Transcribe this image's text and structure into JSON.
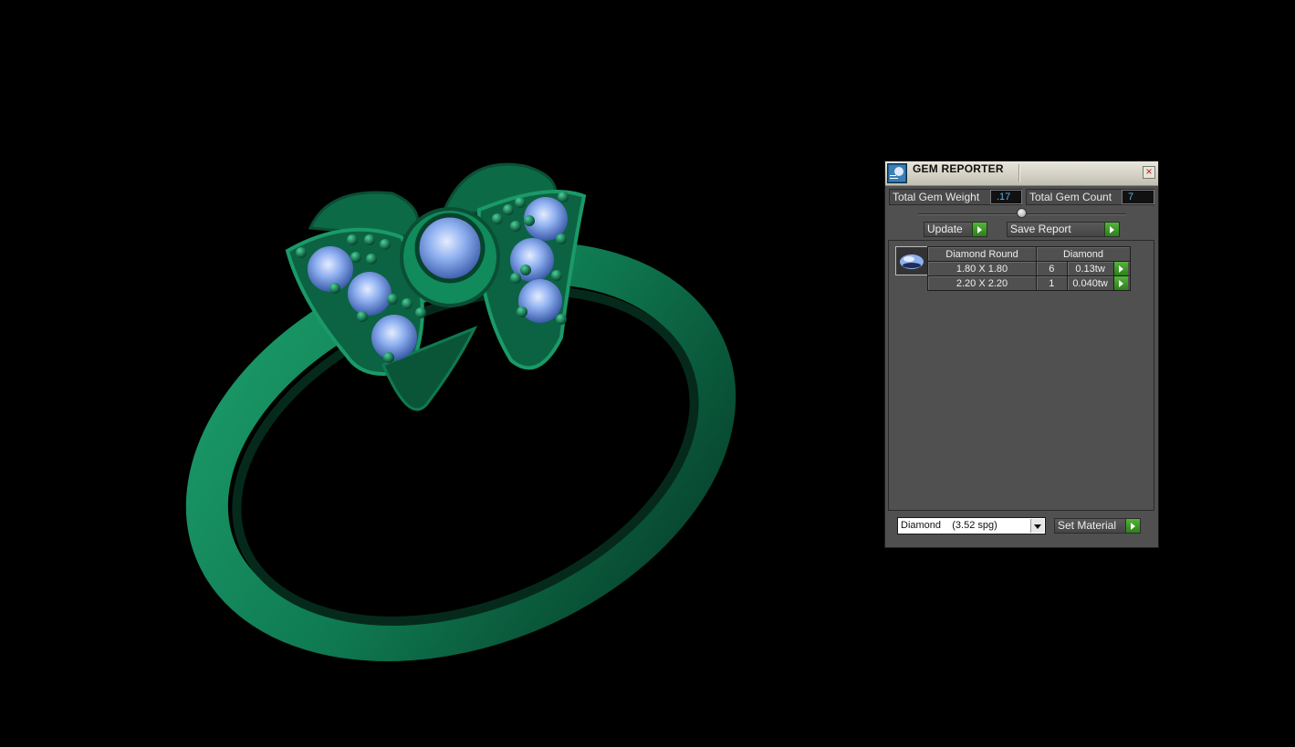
{
  "title": "GEM REPORTER",
  "close_glyph": "×",
  "totals": {
    "weight_label": "Total Gem Weight",
    "weight_value": ".17",
    "count_label": "Total Gem Count",
    "count_value": "7"
  },
  "buttons": {
    "update": "Update",
    "save_report": "Save Report",
    "set_material": "Set Material"
  },
  "table": {
    "header_shape": "Diamond Round",
    "header_material": "Diamond",
    "rows": [
      {
        "size": "1.80 X 1.80",
        "count": "6",
        "weight": "0.13tw"
      },
      {
        "size": "2.20 X 2.20",
        "count": "1",
        "weight": "0.040tw"
      }
    ]
  },
  "material": {
    "selected": "Diamond    (3.52 spg)"
  },
  "colors": {
    "metal": "#0f7a52",
    "gem": "#8fb0f0",
    "panel": "#505050",
    "value_text": "#5ab0e8",
    "arrow_button": "#3c9a28"
  },
  "icons": {
    "app": "gem-report-icon",
    "close": "close-icon",
    "arrow": "play-arrow-icon",
    "dropdown": "chevron-down-icon"
  }
}
